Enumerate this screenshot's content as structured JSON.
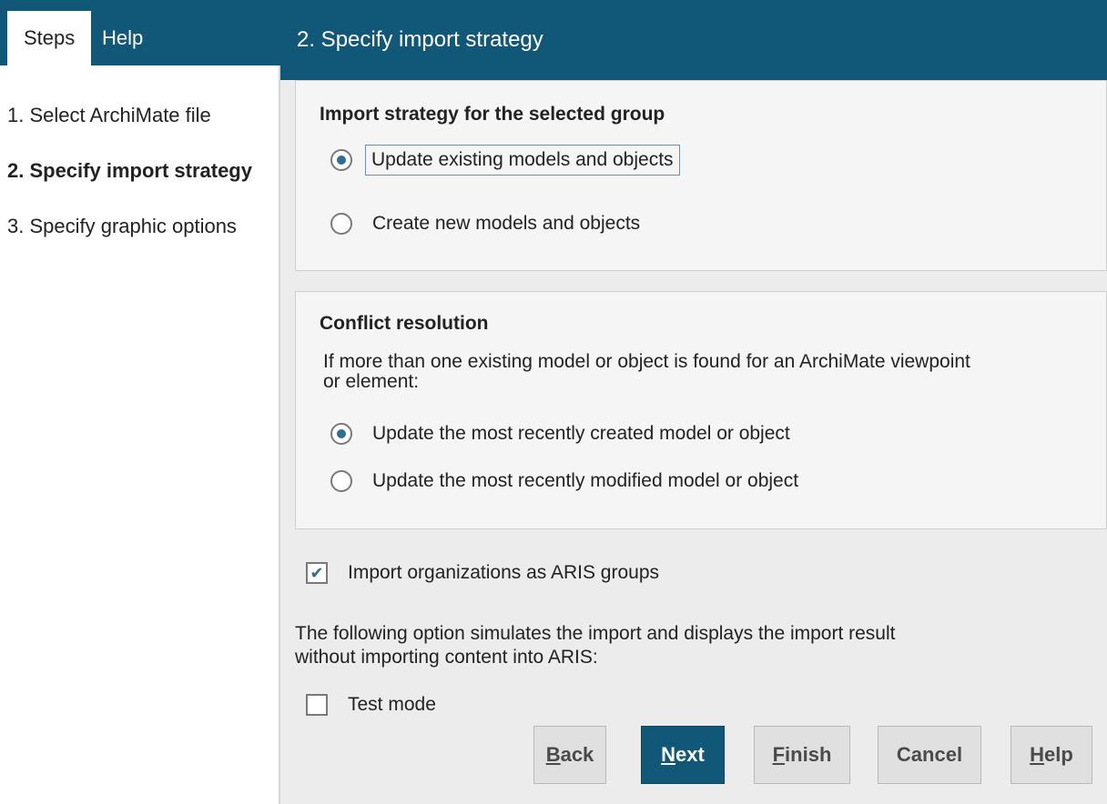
{
  "left": {
    "tabs": [
      {
        "label": "Steps",
        "active": true
      },
      {
        "label": "Help",
        "active": false
      }
    ],
    "steps": [
      {
        "label": "1. Select ArchiMate file",
        "current": false
      },
      {
        "label": "2. Specify import strategy",
        "current": true
      },
      {
        "label": "3. Specify graphic options",
        "current": false
      }
    ]
  },
  "header": {
    "title": "2. Specify import strategy"
  },
  "strategy": {
    "title": "Import strategy for the selected group",
    "options": [
      {
        "label": "Update existing models and objects",
        "selected": true
      },
      {
        "label": "Create new models and objects",
        "selected": false
      }
    ]
  },
  "conflict": {
    "title": "Conflict resolution",
    "description_line1": "If more than one existing model or object is found for an ArchiMate viewpoint",
    "description_line2": "or element:",
    "options": [
      {
        "label": "Update the most recently created model or object",
        "selected": true
      },
      {
        "label": "Update the most recently modified model or object",
        "selected": false
      }
    ]
  },
  "import_orgs": {
    "label": "Import organizations as ARIS groups",
    "checked": true
  },
  "simulation": {
    "line1": "The following option simulates the import and displays the import result",
    "line2": "without importing content into ARIS:"
  },
  "test_mode": {
    "label": "Test mode",
    "checked": false
  },
  "buttons": {
    "back": {
      "mnemonic": "B",
      "rest": "ack"
    },
    "next": {
      "mnemonic": "N",
      "rest": "ext"
    },
    "finish": {
      "mnemonic": "F",
      "rest": "inish"
    },
    "cancel": {
      "label": "Cancel"
    },
    "help": {
      "mnemonic": "H",
      "rest": "elp"
    }
  },
  "colors": {
    "accent": "#115878",
    "panel": "#ececec"
  }
}
